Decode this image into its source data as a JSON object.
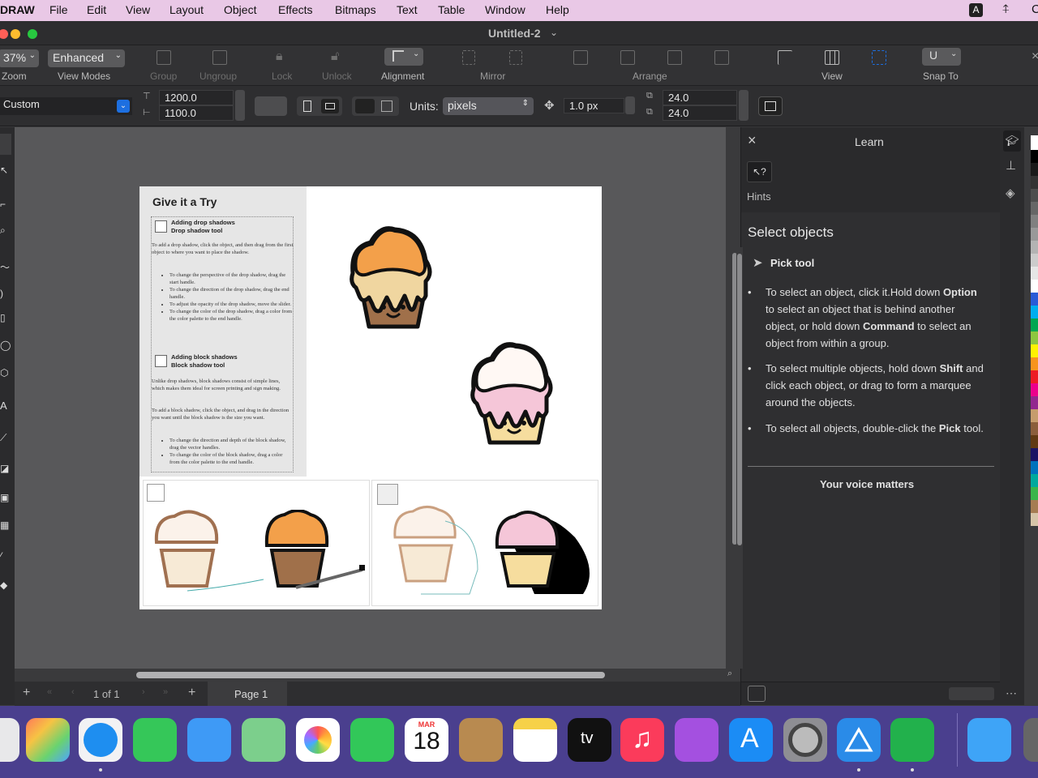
{
  "menubar": {
    "app": "DRAW",
    "items": [
      "File",
      "Edit",
      "View",
      "Layout",
      "Object",
      "Effects",
      "Bitmaps",
      "Text",
      "Table",
      "Window",
      "Help"
    ],
    "input_badge": "A"
  },
  "window": {
    "title": "Untitled-2"
  },
  "toolbar": {
    "zoom_value": "37%",
    "zoom_label": "Zoom",
    "view_mode_value": "Enhanced",
    "view_mode_label": "View Modes",
    "group": "Group",
    "ungroup": "Ungroup",
    "lock": "Lock",
    "unlock": "Unlock",
    "alignment": "Alignment",
    "mirror": "Mirror",
    "arrange": "Arrange",
    "view": "View",
    "snap_to": "Snap To"
  },
  "propbar": {
    "page_size": "Custom",
    "width": "1200.0",
    "height": "1100.0",
    "units_label": "Units:",
    "units_value": "pixels",
    "nudge": "1.0 px",
    "dup_x": "24.0",
    "dup_y": "24.0"
  },
  "document": {
    "heading": "Give it a Try",
    "drop_title": "Adding drop shadows",
    "drop_sub": "Drop shadow tool",
    "drop_intro": "To add a drop shadow, click the object, and then drag from the first object to where you want to place the shadow.",
    "drop_bullets": [
      "To change the perspective of the drop shadow, drag the start handle.",
      "To change the direction of the drop shadow, drag the end handle.",
      "To adjust the opacity of the drop shadow, move the slider.",
      "To change the color of the drop shadow, drag a color from the color palette to the end handle."
    ],
    "block_title": "Adding block shadows",
    "block_sub": "Block shadow tool",
    "block_intro": "Unlike drop shadows, block shadows consist of simple lines, which makes them ideal for screen printing and sign making.",
    "block_intro2": "To add a block shadow, click the object, and drag in the direction you want until the block shadow is the size you want.",
    "block_bullets": [
      "To change the direction and depth of the block shadow, drag the vector handles.",
      "To change the color of the block shadow, drag a color from the color palette to the end handle."
    ]
  },
  "status": {
    "page_count": "1 of 1",
    "page_tab": "Page 1"
  },
  "learn": {
    "title": "Learn",
    "hints": "Hints",
    "section": "Select objects",
    "tool": "Pick tool",
    "p1_a": "To select an object, click it.Hold down ",
    "p1_b": "Option",
    "p1_c": " to select an object that is behind another object, or hold down ",
    "p1_d": "Command",
    "p1_e": " to select an object from within a group.",
    "p2_a": "To select multiple objects, hold down ",
    "p2_b": "Shift",
    "p2_c": " and click each object, or drag to form a marquee around the objects.",
    "p3_a": "To select all objects, double-click the ",
    "p3_b": "Pick",
    "p3_c": " tool.",
    "feedback": "Your voice matters"
  },
  "dock": {
    "calendar_month": "MAR",
    "calendar_day": "18",
    "tv": "tv"
  },
  "colors": {
    "accent": "#1d6fe0",
    "menubar": "#e9c8e6",
    "dock": "#4a3f8e"
  }
}
